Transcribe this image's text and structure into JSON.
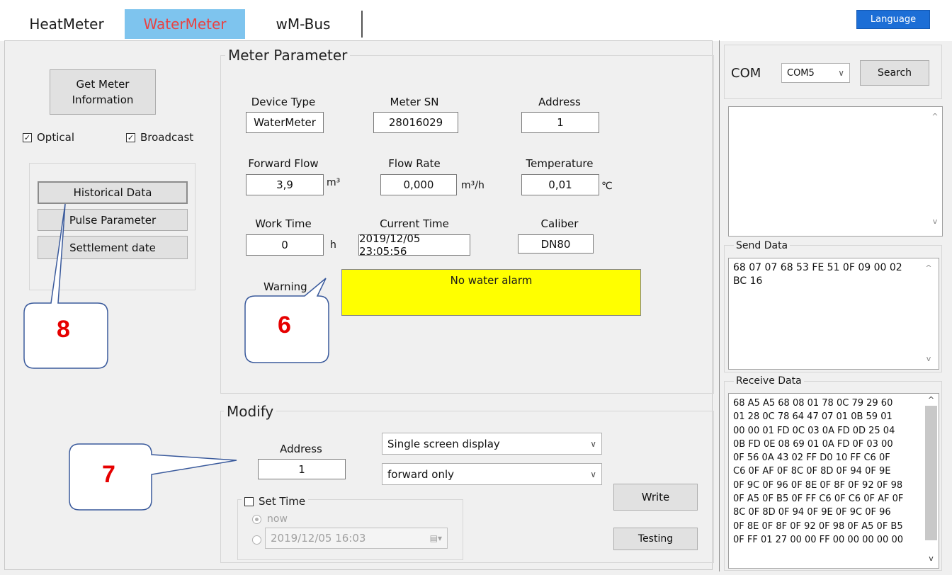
{
  "tabs": [
    {
      "label": "HeatMeter"
    },
    {
      "label": "WaterMeter"
    },
    {
      "label": "wM-Bus"
    }
  ],
  "language_button": "Language",
  "left": {
    "get_info_button": [
      "Get Meter",
      "Information"
    ],
    "optical_label": "Optical",
    "broadcast_label": "Broadcast",
    "menu": [
      "Historical Data",
      "Pulse Parameter",
      "Settlement date"
    ]
  },
  "meter_parameter": {
    "title": "Meter Parameter",
    "device_type": {
      "label": "Device Type",
      "value": "WaterMeter"
    },
    "meter_sn": {
      "label": "Meter  SN",
      "value": "28016029"
    },
    "address": {
      "label": "Address",
      "value": "1"
    },
    "forward_flow": {
      "label": "Forward Flow",
      "value": "3,9",
      "unit": "m³"
    },
    "flow_rate": {
      "label": "Flow Rate",
      "value": "0,000",
      "unit": "m³/h"
    },
    "temperature": {
      "label": "Temperature",
      "value": "0,01",
      "unit": "℃"
    },
    "work_time": {
      "label": "Work Time",
      "value": "0",
      "unit": "h"
    },
    "current_time": {
      "label": "Current Time",
      "value": "2019/12/05 23:05:56"
    },
    "caliber": {
      "label": "Caliber",
      "value": "DN80"
    },
    "warning": {
      "label": "Warning",
      "value": "No water alarm"
    }
  },
  "modify": {
    "title": "Modify",
    "address_label": "Address",
    "address_value": "1",
    "display_select": "Single screen display",
    "direction_select": "forward only",
    "set_time_label": "Set Time",
    "now_label": "now",
    "datetime_value": "2019/12/05 16:03",
    "write_button": "Write",
    "testing_button": "Testing"
  },
  "com": {
    "label": "COM",
    "port": "COM5",
    "search_button": "Search"
  },
  "send_data": {
    "label": "Send Data",
    "lines": [
      "68 07 07 68 53 FE 51 0F 09 00 02",
      "BC 16"
    ]
  },
  "receive_data": {
    "label": "Receive Data",
    "lines": [
      "68 A5 A5 68 08 01 78 0C 79 29 60",
      "01 28 0C 78 64 47 07 01 0B 59 01",
      "00 00 01 FD 0C 03 0A FD 0D 25 04",
      "0B FD 0E 08 69 01 0A FD 0F 03 00",
      "0F 56 0A 43 02 FF D0 10 FF C6 0F",
      "C6 0F AF 0F 8C 0F 8D 0F 94 0F 9E",
      "0F 9C 0F 96 0F 8E 0F 8F 0F 92 0F 98",
      "0F A5 0F B5 0F FF C6 0F C6 0F AF 0F",
      "8C 0F 8D 0F 94 0F 9E 0F 9C 0F 96",
      "0F 8E 0F 8F 0F 92 0F 98 0F A5 0F B5",
      "0F FF 01 27 00 00 FF 00 00 00 00 00"
    ]
  },
  "callouts": {
    "c6": "6",
    "c7": "7",
    "c8": "8"
  },
  "colors": {
    "alarm": "#ffff00",
    "tab_active": "#7ec4ee",
    "tab_active_text": "#e94242",
    "language": "#1c6ed6",
    "callout_text": "#e60000",
    "callout_line": "#3a5a9c"
  }
}
